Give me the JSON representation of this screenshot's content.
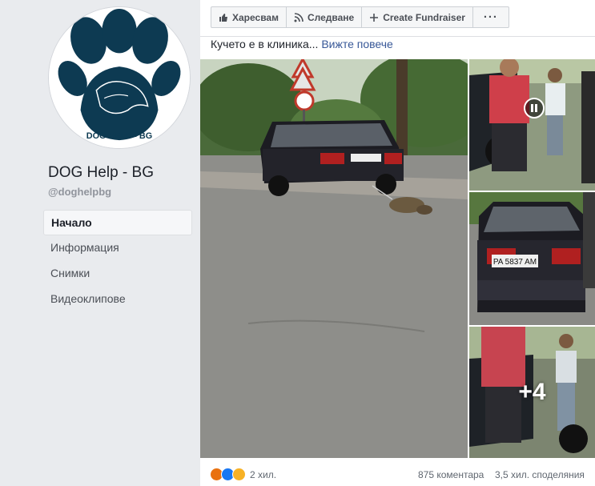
{
  "page": {
    "name": "DOG Help - BG",
    "handle": "@doghelpbg",
    "logo_text": "DOG HELP - BG"
  },
  "sidebar": {
    "items": [
      {
        "label": "Начало",
        "active": true
      },
      {
        "label": "Информация",
        "active": false
      },
      {
        "label": "Снимки",
        "active": false
      },
      {
        "label": "Видеоклипове",
        "active": false
      }
    ]
  },
  "toolbar": {
    "like_label": "Харесвам",
    "follow_label": "Следване",
    "fundraiser_label": "Create Fundraiser",
    "more_label": "···"
  },
  "post": {
    "text": "Кучето е в клиника...",
    "see_more": "Вижте повече",
    "more_photos": "+4",
    "plate": "PA 5837 AM"
  },
  "footer": {
    "reaction_count": "2 хил.",
    "comments": "875 коментара",
    "shares": "3,5 хил. споделяния"
  },
  "colors": {
    "brand": "#385898",
    "logo_blue": "#0d3a52",
    "background": "#e9ebee"
  },
  "icons": [
    "like-thumb-icon",
    "rss-follow-icon",
    "plus-icon",
    "more-dots-icon",
    "pause-icon",
    "angry-reaction-icon",
    "like-reaction-icon",
    "sad-reaction-icon"
  ]
}
